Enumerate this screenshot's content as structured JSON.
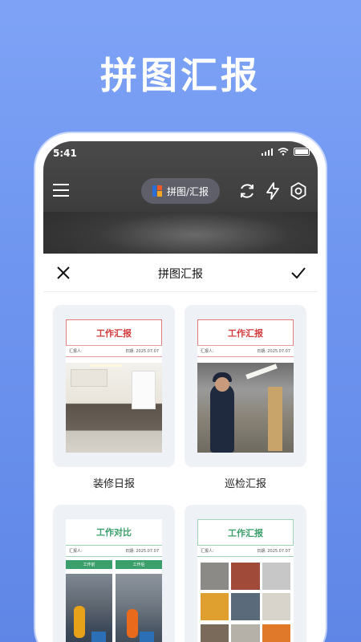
{
  "hero": {
    "title": "拼图汇报"
  },
  "status": {
    "time": "5:41"
  },
  "toolbar": {
    "mode_label": "拼图/汇报"
  },
  "sheet": {
    "title": "拼图汇报"
  },
  "templates": [
    {
      "name": "装修日报",
      "paper_title": "工作汇报",
      "reporter": "汇报人:",
      "date": "日期: 2025.07.07"
    },
    {
      "name": "巡检汇报",
      "paper_title": "工作汇报",
      "reporter": "汇报人:",
      "date": "日期: 2025.07.07"
    },
    {
      "name": "",
      "paper_title": "工作对比",
      "reporter": "汇报人:",
      "date": "日期: 2025.07.07",
      "before": "工作前",
      "after": "工作后"
    },
    {
      "name": "",
      "paper_title": "工作汇报",
      "reporter": "汇报人:",
      "date": "日期: 2025.07.07"
    }
  ],
  "colors": {
    "accent_red": "#d23b3b",
    "accent_green": "#3a9f6a",
    "bg_blue": "#6f96f0"
  }
}
